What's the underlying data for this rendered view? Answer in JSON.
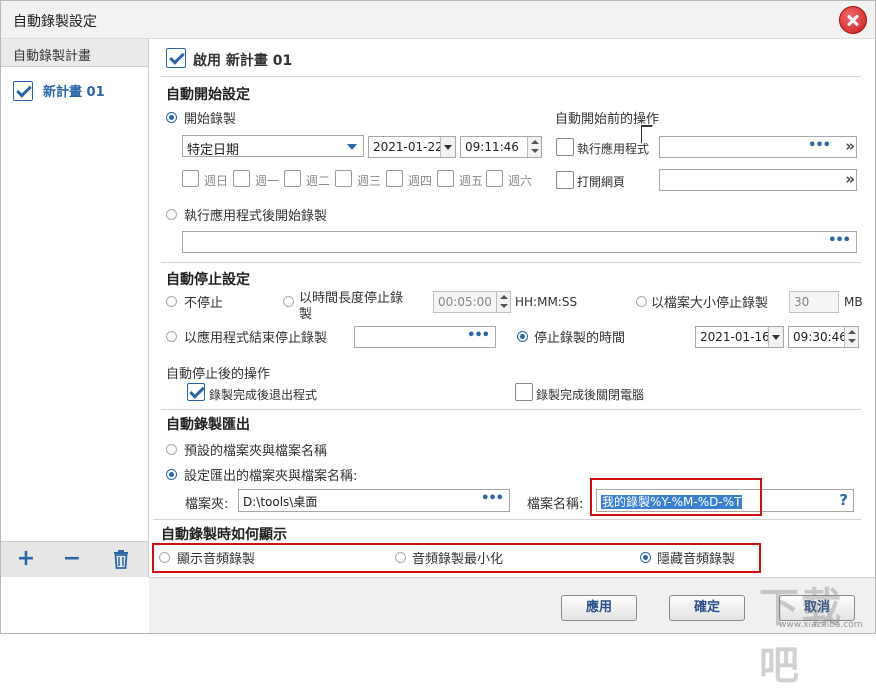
{
  "window": {
    "title": "自動錄製設定"
  },
  "sidebar": {
    "header": "自動錄製計畫",
    "items": [
      {
        "label": "新計畫 01",
        "checked": true
      }
    ],
    "footer": {
      "add": "+",
      "remove": "−"
    }
  },
  "plan": {
    "enable_label": "啟用 新計畫 01",
    "enabled": true
  },
  "auto_start": {
    "title": "自動開始設定",
    "start_record_label": "開始錄製",
    "mode_value": "特定日期",
    "date_value": "2021-01-22",
    "time_value": "09:11:46",
    "weekdays": [
      "週日",
      "週一",
      "週二",
      "週三",
      "週四",
      "週五",
      "週六"
    ],
    "after_app_label": "執行應用程式後開始錄製",
    "pre_action_title": "自動開始前的操作",
    "run_app_label": "執行應用程式",
    "open_web_label": "打開網頁",
    "dots": "•••",
    "chev": "»"
  },
  "auto_stop": {
    "title": "自動停止設定",
    "no_stop_label": "不停止",
    "by_duration_label_1": "以時間長度停止錄",
    "by_duration_label_2": "製",
    "duration_value": "00:05:00",
    "duration_format": "HH:MM:SS",
    "by_size_label": "以檔案大小停止錄製",
    "size_value": "30",
    "size_unit": "MB",
    "by_app_end_label": "以應用程式結束停止錄製",
    "stop_time_label": "停止錄製的時間",
    "stop_date_value": "2021-01-16",
    "stop_time_value": "09:30:46",
    "after_stop_title": "自動停止後的操作",
    "exit_app_label": "錄製完成後退出程式",
    "shutdown_label": "錄製完成後關閉電腦"
  },
  "export": {
    "title": "自動錄製匯出",
    "default_label": "預設的檔案夾與檔案名稱",
    "custom_label": "設定匯出的檔案夾與檔案名稱:",
    "folder_label": "檔案夾:",
    "folder_value": "D:\\tools\\桌面",
    "filename_label": "檔案名稱:",
    "filename_value": "我的錄製%Y-%M-%D-%T",
    "help": "?"
  },
  "display": {
    "title": "自動錄製時如何顯示",
    "show_label": "顯示音頻錄製",
    "minimize_label": "音頻錄製最小化",
    "hide_label": "隱藏音頻錄製"
  },
  "buttons": {
    "apply": "應用",
    "ok": "確定",
    "cancel": "取消"
  },
  "watermark": {
    "mark": "下载吧",
    "url": "www.xiazaiba.com"
  },
  "colors": {
    "accent": "#2a66a8",
    "highlight": "#d01010",
    "close": "#c91e1e"
  }
}
